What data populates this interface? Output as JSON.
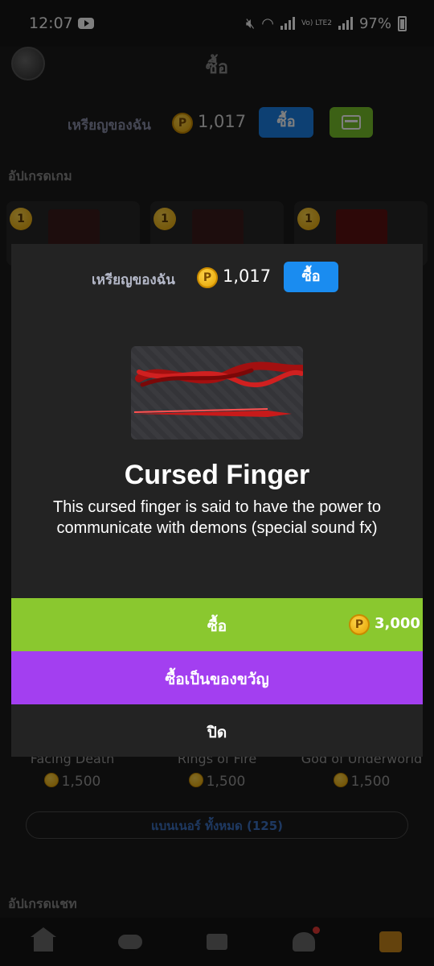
{
  "status": {
    "time": "12:07",
    "battery": "97%",
    "network": "Vo) LTE2"
  },
  "header": {
    "title": "ซื้อ"
  },
  "wallet": {
    "label": "เหรียญของฉัน",
    "amount": "1,017",
    "buy_label": "ซื้อ"
  },
  "sections": {
    "game_upgrades": "อัปเกรดเกม",
    "chat_upgrades": "อัปเกรดแชท"
  },
  "cards_top": [
    {
      "badge": "1"
    },
    {
      "badge": "1"
    },
    {
      "badge": "1"
    }
  ],
  "cards_bottom": [
    {
      "name": "Facing Death",
      "price": "1,500"
    },
    {
      "name": "Rings of Fire",
      "price": "1,500"
    },
    {
      "name": "God of Underworld",
      "price": "1,500"
    }
  ],
  "all_banners": "แบนเนอร์ ทั้งหมด (125)",
  "modal": {
    "coins_label": "เหรียญของฉัน",
    "coins_amount": "1,017",
    "buy_coins_label": "ซื้อ",
    "item_title": "Cursed Finger",
    "item_description": "This cursed finger is said to have the power to communicate with demons (special sound fx)",
    "buy_label": "ซื้อ",
    "price": "3,000",
    "gift_label": "ซื้อเป็นของขวัญ",
    "close_label": "ปิด"
  },
  "colors": {
    "buy_green": "#8ac82f",
    "gift_purple": "#a33ff0",
    "accent_blue": "#1a8cf0",
    "coin_gold": "#ffc107"
  },
  "tabs": [
    "home-icon",
    "gamepad-icon",
    "chat-icon",
    "friends-icon",
    "shop-icon"
  ]
}
